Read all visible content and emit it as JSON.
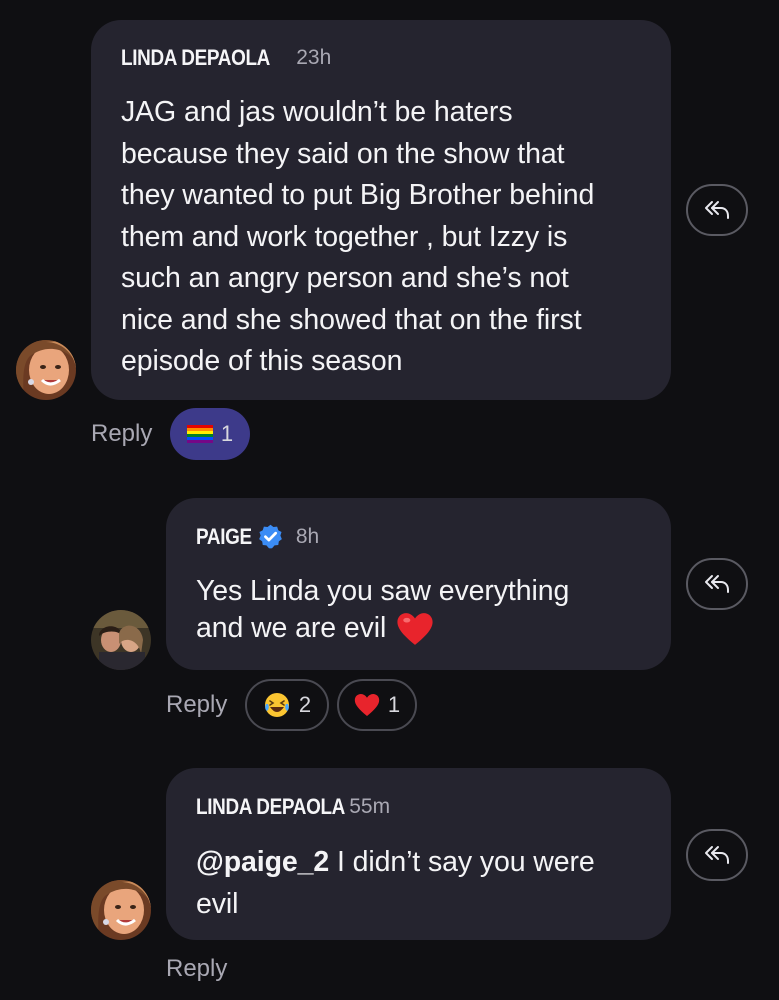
{
  "comments": [
    {
      "author": "LINDA DEPAOLA",
      "time": "23h",
      "text_lines": [
        "JAG and jas wouldn’t be haters",
        "because they said on the show that",
        "they wanted to put Big Brother behind",
        "them and work together , but Izzy is",
        "such an angry person and she’s not",
        "nice and she showed that on the first",
        "episode of this season"
      ],
      "reply_label": "Reply",
      "reactions": [
        {
          "emoji": "rainbow-flag",
          "count": "1"
        }
      ]
    },
    {
      "author": "PAIGE",
      "verified": true,
      "time": "8h",
      "text_lines": [
        "Yes Linda you saw everything",
        "and we are evil"
      ],
      "text_emoji": "red-heart",
      "reply_label": "Reply",
      "reactions": [
        {
          "emoji": "laughing-crying",
          "count": "2"
        },
        {
          "emoji": "red-heart",
          "count": "1"
        }
      ]
    },
    {
      "author": "LINDA DEPAOLA",
      "time": "55m",
      "mention": "@paige_2",
      "text_rest": " I didn’t say you were",
      "text_line2": "evil",
      "reply_label": "Reply"
    }
  ],
  "icons": {
    "reply_arrow": "reply-all-arrow-icon",
    "verified": "verified-badge-icon"
  },
  "colors": {
    "background": "#0f0f12",
    "bubble": "#25242f",
    "selected_reaction": "#3d3a8a",
    "verified_blue": "#3b8cf5",
    "heart": "#e8242c"
  }
}
